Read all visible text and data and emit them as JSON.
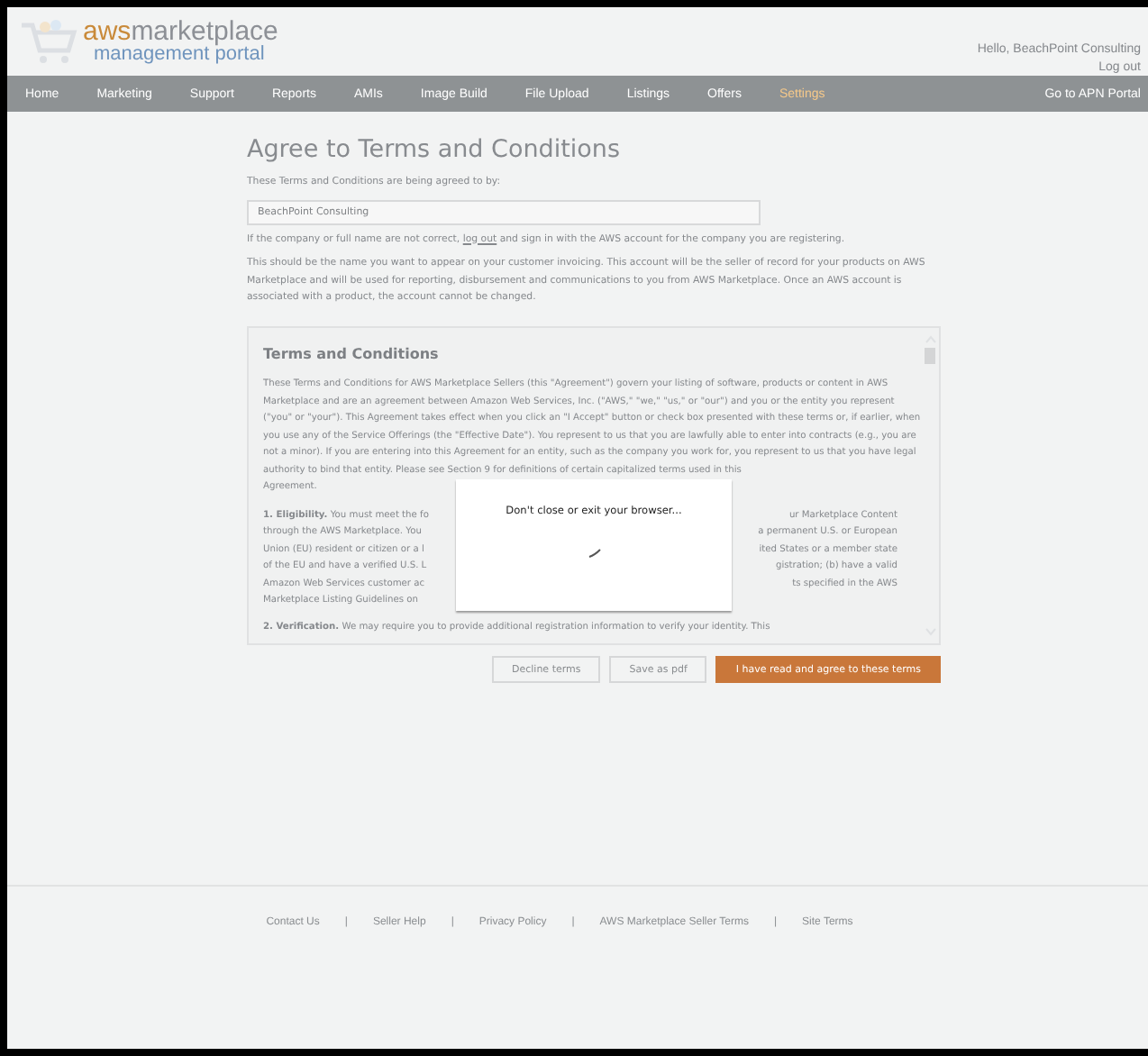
{
  "header": {
    "logo_brand": "aws",
    "logo_product": "marketplace",
    "logo_sub": "management portal",
    "greeting": "Hello, BeachPoint Consulting",
    "logout": "Log out"
  },
  "nav": {
    "items": [
      {
        "label": "Home",
        "selected": false
      },
      {
        "label": "Marketing",
        "selected": false
      },
      {
        "label": "Support",
        "selected": false
      },
      {
        "label": "Reports",
        "selected": false
      },
      {
        "label": "AMIs",
        "selected": false
      },
      {
        "label": "Image Build",
        "selected": false
      },
      {
        "label": "File Upload",
        "selected": false
      },
      {
        "label": "Listings",
        "selected": false
      },
      {
        "label": "Offers",
        "selected": false
      },
      {
        "label": "Settings",
        "selected": true
      }
    ],
    "right_link": "Go to APN Portal"
  },
  "page": {
    "title": "Agree to Terms and Conditions",
    "agreed_by_label": "These Terms and Conditions are being agreed to by:",
    "company_field": "BeachPoint Consulting",
    "correction_before": "If the company or full name are not correct, ",
    "correction_link": "log out",
    "correction_after": " and sign in with the AWS account for the company you are registering.",
    "note": "This should be the name you want to appear on your customer invoicing. This account will be the seller of record for your products on AWS Marketplace and will be used for reporting, disbursement and communications to you from AWS Marketplace. Once an AWS account is associated with a product, the account cannot be changed."
  },
  "terms": {
    "heading": "Terms and Conditions",
    "intro": "These Terms and Conditions for AWS Marketplace Sellers (this \"Agreement\") govern your listing of software, products or content in AWS Marketplace and are an agreement between Amazon Web Services, Inc. (\"AWS,\" \"we,\" \"us,\" or \"our\") and you or the entity you represent (\"you\" or \"your\"). This Agreement takes effect when you click an \"I Accept\" button or check box presented with these terms or, if earlier, when you use any of the Service Offerings (the \"Effective Date\"). You represent to us that you are lawfully able to enter into contracts (e.g., you are not a minor). If you are entering into this Agreement for an entity, such as the company you work for, you represent to us that you have legal authority to bind that entity. Please see Section 9 for definitions of certain capitalized terms used in this",
    "intro_end": "Agreement.",
    "eligibility_lines": [
      {
        "left": "**1. Eligibility.** You must meet the fo",
        "right": "ur Marketplace Content"
      },
      {
        "left": "through the AWS Marketplace. You",
        "right": "a permanent U.S. or European"
      },
      {
        "left": "Union (EU) resident or citizen or a l",
        "right": "ited States or a member state"
      },
      {
        "left": "of the EU and have a verified U.S. L",
        "right": "gistration; (b) have a valid"
      },
      {
        "left": "Amazon Web Services customer ac",
        "right": "ts specified in the AWS"
      },
      {
        "left": "Marketplace Listing Guidelines on"
      }
    ],
    "verification": "**2. Verification.** We may require you to provide additional registration information to verify your identity. This"
  },
  "buttons": [
    {
      "label": "Decline terms",
      "kind": "secondary"
    },
    {
      "label": "Save as pdf",
      "kind": "secondary"
    },
    {
      "label": "I have read and agree to these terms",
      "kind": "primary"
    }
  ],
  "modal": {
    "message": "Don't close or exit your browser..."
  },
  "footer": {
    "links": [
      "Contact Us",
      "Seller Help",
      "Privacy Policy",
      "AWS Marketplace Seller Terms",
      "Site Terms"
    ],
    "separator": "|"
  }
}
